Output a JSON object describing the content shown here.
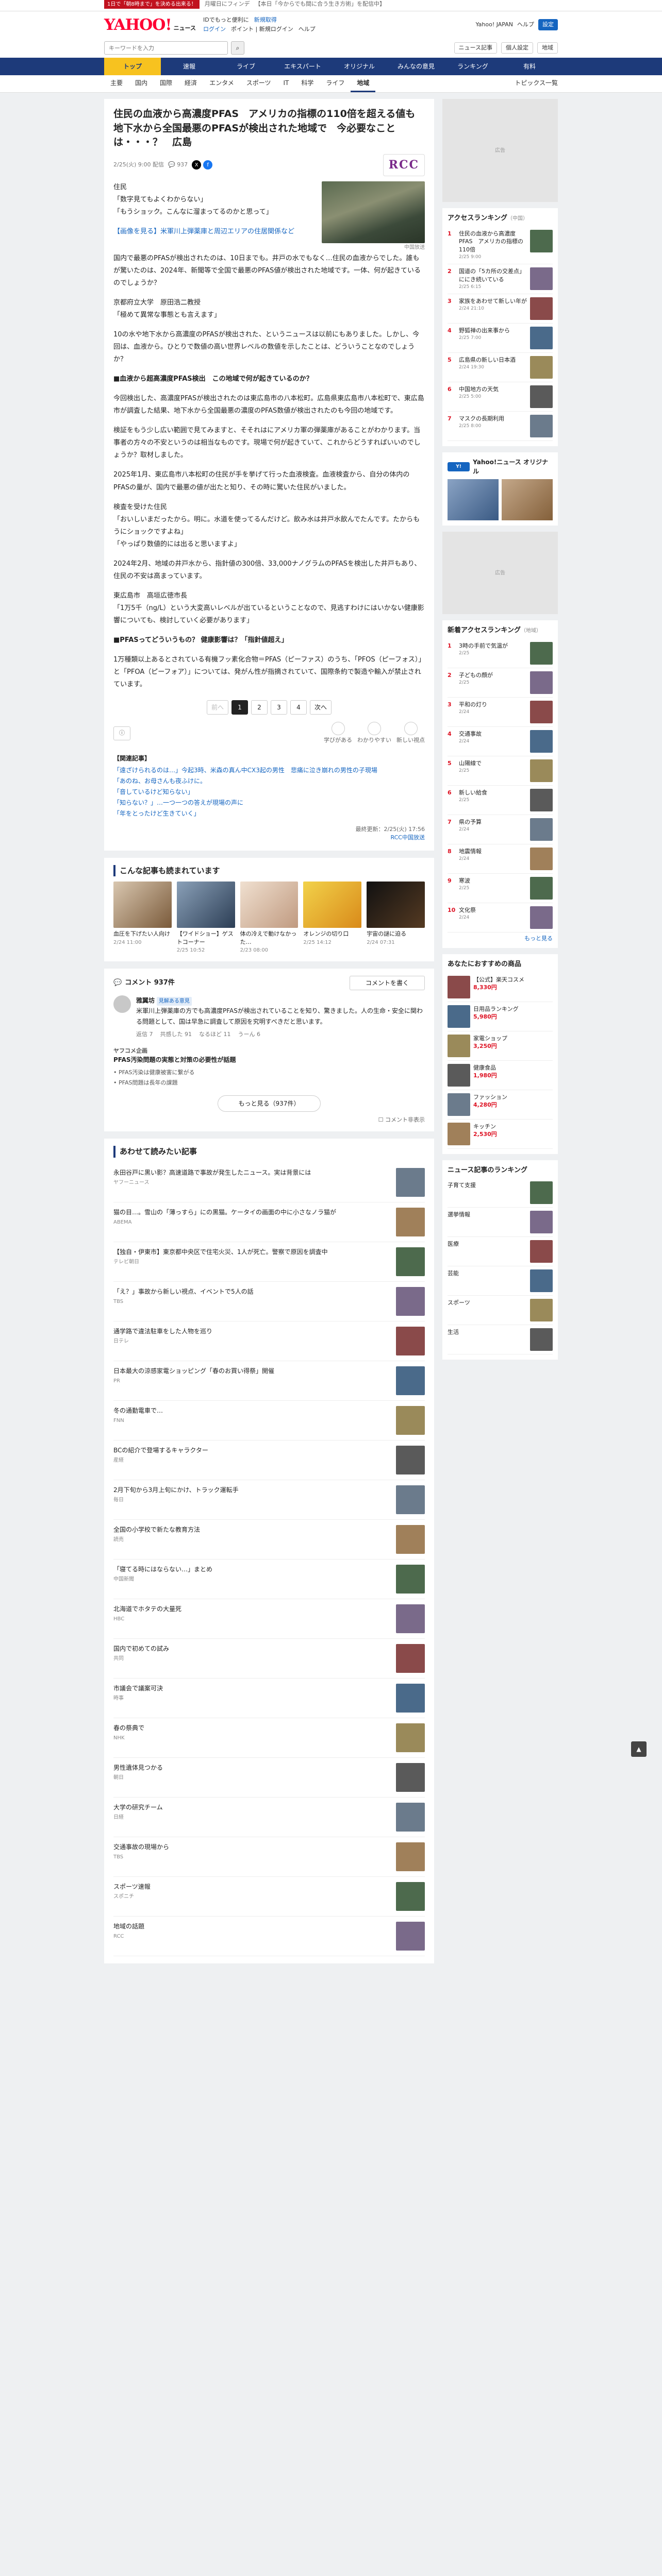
{
  "topstrip": {
    "promo": "1日で「朝8時まで」を決める出来る！",
    "notice": "月曜日にフィンデ",
    "news": "【本日「今からでも間に合う生き方術」を配信中】"
  },
  "header": {
    "brand": "YAHOO!",
    "brand_sub": "ニュース",
    "links_row1": [
      "IDでもっと便利に",
      "新規取得"
    ],
    "links_row2": [
      "ログイン",
      "ポイント | 新規ログイン",
      "ヘルプ"
    ],
    "right_links": [
      "Yahoo! JAPAN",
      "ヘルプ"
    ],
    "right_btn": "設定"
  },
  "search": {
    "placeholder": "キーワードを入力",
    "button": "検索",
    "right": [
      "ニュース記事",
      "個人設定",
      "地域"
    ]
  },
  "nav": [
    "トップ",
    "速報",
    "ライブ",
    "エキスパート",
    "オリジナル",
    "みんなの意見",
    "ランキング",
    "有料"
  ],
  "nav_active": "トップ",
  "subnav": [
    "主要",
    "国内",
    "国際",
    "経済",
    "エンタメ",
    "スポーツ",
    "IT",
    "科学",
    "ライフ",
    "地域"
  ],
  "subnav_active": "地域",
  "subnav_right": "トピックス一覧",
  "article": {
    "title": "住民の血液から高濃度PFAS　アメリカの指標の110倍を超える値も　地下水から全国最悪のPFASが検出された地域で　今必要なことは・・・？　広島",
    "date": "2/25(火) 9:00 配信",
    "comments": "937",
    "source": "RCC",
    "p1": "住民\n「数字見てもよくわからない」\n「もうショック。こんなに溜まってるのかと思って」",
    "photo_caption": "中国放送",
    "lead_link": "【画像を見る】米軍川上弾薬庫と周辺エリアの住居関係など",
    "p2": "国内で最悪のPFASが検出されたのは、10日までも。井戸の水でもなく…住民の血液からでした。誰もが驚いたのは、2024年、新聞等で全国で最悪のPFAS値が検出された地域です。一体、何が起きているのでしょうか？",
    "p3": "京都府立大学　原田浩二教授\n「極めて異常な事態とも言えます」",
    "p4": "10の水や地下水から高濃度のPFASが検出された、というニュースは以前にもありました。しかし、今回は、血液から。ひとりで数値の高い世界レベルの数値を示したことは、どういうことなのでしょうか？",
    "p5": "■血液から超高濃度PFAS検出　この地域で何が起きているのか？",
    "p6": "今回検出した、高濃度PFASが検出されたのは東広島市の八本松町。広島県東広島市八本松町で、東広島市が調査した結果、地下水から全国最悪の濃度のPFAS数値が検出されたのも今回の地域です。",
    "p7": "検証をもう少し広い範囲で見てみますと、そそれはにアメリカ軍の弾薬庫があることがわかります。当事者の方々の不安というのは相当なものです。現場で何が起きていて、これからどうすればいいのでしょうか？取材しました。",
    "p8": "2025年1月、東広島市八本松町の住民が手を挙げて行った血液検査。血液検査から、自分の体内のPFASの量が、国内で最悪の値が出たと知り、その時に驚いた住民がいました。",
    "p9": "検査を受けた住民\n「おいしいまだったから。明に。水道を使ってるんだけど。飲み水は井戸水飲んでたんです。たからもうにショックですよね」\n「やっぱり数値的には出ると思いますよ」",
    "p10": "2024年2月、地域の井戸水から、指針値の300倍、33,000ナノグラムのPFASを検出した井戸もあり、住民の不安は高まっています。",
    "p11": "東広島市　高垣広徳市長\n「1万5千（ng/L）という大変高いレベルが出ているということなので、見逃すわけにはいかない健康影響についても、検討していく必要があります」",
    "p12": "■PFASってどういうもの？ 健康影響は？「指針値超え」",
    "p13": "1万種類以上あるとされている有機フッ素化合物＝PFAS（ピーファス）のうち、「PFOS（ピーフォス）」と「PFOA（ピーフォア）」については、発がん性が指摘されていて、国際条約で製造や輸入が禁止されています。",
    "pages": [
      "前へ",
      "1",
      "2",
      "3",
      "4",
      "次へ"
    ],
    "reactions": [
      "学びがある",
      "わかりやすい",
      "新しい視点"
    ],
    "related_hd": "【関連記事】",
    "related": [
      "「遠ざけられるのは…」今起3時、米森の真ん中CX3起の男性　悲痛に泣き崩れの男性の子現場",
      "「あのね、お母さんも夜ふけに。",
      "「音しているけど知らない」",
      "「知らない？」…一つ一つの答えが現場の声に",
      "「年をとったけど生きていく」"
    ],
    "foot_src": "最終更新：2/25(火) 17:56",
    "foot_rcc": "RCC中国放送"
  },
  "read_also": {
    "title": "こんな記事も読まれています",
    "items": [
      {
        "t": "血圧を下げたい人向け",
        "d": "2/24 11:00"
      },
      {
        "t": "【ワイドショー】ゲストコーナー",
        "d": "2/25 10:52"
      },
      {
        "t": "体の冷えで動けなかった…",
        "d": "2/23 08:00"
      },
      {
        "t": "オレンジの切り口",
        "d": "2/25 14:12"
      },
      {
        "t": "宇宙の謎に迫る",
        "d": "2/24 07:31"
      }
    ]
  },
  "comments": {
    "count_label": "コメント 937件",
    "post": "コメントを書く",
    "author": "雅翼坊",
    "author_badge": "見解ある意見",
    "comment_text": "米軍川上弾薬庫の方でも高濃度PFASが検出されていることを知り、驚きました。人の生命・安全に関わる問題として、国は早急に調査して原因を究明すべきだと思います。",
    "footer": [
      "返信 7",
      "共感した 91",
      "なるほど 11",
      "うーん 6"
    ],
    "opinion_hd": "ヤフコメ企画",
    "opinion_title": "PFAS汚染問題の実態と対策の必要性が話題",
    "opinion_items": [
      "PFAS汚染は健康被害に繋がる",
      "PFAS問題は長年の課題"
    ],
    "more_btn": "もっと見る（937件）",
    "toggle": "コメント非表示"
  },
  "ranking": {
    "title": "あわせて読みたい記事",
    "items": [
      {
        "t": "永田谷戸に黒い影？高速道路で事故が発生したニュース。実は背景には",
        "s": "ヤフーニュース"
      },
      {
        "t": "猫の目…。雪山の「薄っすら」にの黒猫。ケータイの画面の中に小さなノラ猫が",
        "s": "ABEMA"
      },
      {
        "t": "【独自・伊東市】東京都中央区で住宅火災、1人が死亡。警察で原因を調査中",
        "s": "テレビ朝日"
      },
      {
        "t": "「え？」事故から新しい視点、イベントで5人の話",
        "s": "TBS"
      },
      {
        "t": "通学路で違法駐車をした人物を巡り",
        "s": "日テレ"
      },
      {
        "t": "日本最大の涼感家電ショッピング「春のお買い得祭」開催",
        "s": "PR"
      },
      {
        "t": "冬の通勤電車で…",
        "s": "FNN"
      },
      {
        "t": "BCの紹介で登場するキャラクター",
        "s": "産経"
      },
      {
        "t": "2月下旬から3月上旬にかけ、トラック運転手",
        "s": "毎日"
      },
      {
        "t": "全国の小学校で新たな教育方法",
        "s": "読売"
      },
      {
        "t": "「寝てる時にはならない…」まとめ",
        "s": "中国新聞"
      },
      {
        "t": "北海道でホタテの大量死",
        "s": "HBC"
      },
      {
        "t": "国内で初めての試み",
        "s": "共同"
      },
      {
        "t": "市議会で議案可決",
        "s": "時事"
      },
      {
        "t": "春の祭典で",
        "s": "NHK"
      },
      {
        "t": "男性遺体見つかる",
        "s": "朝日"
      },
      {
        "t": "大学の研究チーム",
        "s": "日経"
      },
      {
        "t": "交通事故の現場から",
        "s": "TBS"
      },
      {
        "t": "スポーツ速報",
        "s": "スポニチ"
      },
      {
        "t": "地域の話題",
        "s": "RCC"
      }
    ]
  },
  "sidebar": {
    "ad_label": "広告",
    "access_title": "アクセスランキング",
    "access_sub": "（中国）",
    "access": [
      {
        "t": "住民の血液から高濃度PFAS　アメリカの指標の110倍",
        "m": "2/25 9:00"
      },
      {
        "t": "国道の「5カ所の交差点」ににき続いている",
        "m": "2/25 6:15"
      },
      {
        "t": "家族をあわせて新しい年が",
        "m": "2/24 21:10"
      },
      {
        "t": "野狐禅の出来事から",
        "m": "2/25 7:00"
      },
      {
        "t": "広島県の新しい日本酒",
        "m": "2/24 19:30"
      },
      {
        "t": "中国地方の天気",
        "m": "2/25 5:00"
      },
      {
        "t": "マスクの長期利用",
        "m": "2/25 8:00"
      }
    ],
    "yt_title": "Yahoo!ニュース オリジナル",
    "news_title": "新着アクセスランキング",
    "news_sub": "（地域）",
    "news": [
      {
        "t": "3時の手前で気温が",
        "m": "2/25"
      },
      {
        "t": "子どもの顔が",
        "m": "2/25"
      },
      {
        "t": "平和の灯り",
        "m": "2/24"
      },
      {
        "t": "交通事故",
        "m": "2/24"
      },
      {
        "t": "山陽線で",
        "m": "2/25"
      },
      {
        "t": "新しい給食",
        "m": "2/25"
      },
      {
        "t": "県の予算",
        "m": "2/24"
      },
      {
        "t": "地震情報",
        "m": "2/24"
      },
      {
        "t": "寒波",
        "m": "2/25"
      },
      {
        "t": "文化祭",
        "m": "2/24"
      }
    ],
    "pick": "もっと見る",
    "shop_title": "あなたにおすすめの商品",
    "shop": [
      {
        "t": "【公式】楽天コスメ",
        "p": "8,330円"
      },
      {
        "t": "日用品ランキング",
        "p": "5,980円"
      },
      {
        "t": "家電ショップ",
        "p": "3,250円"
      },
      {
        "t": "健康食品",
        "p": "1,980円"
      },
      {
        "t": "ファッション",
        "p": "4,280円"
      },
      {
        "t": "キッチン",
        "p": "2,530円"
      }
    ],
    "topic_title": "ニュース記事のランキング",
    "topic": [
      {
        "t": "子育て支援",
        "m": ""
      },
      {
        "t": "選挙情報",
        "m": ""
      },
      {
        "t": "医療",
        "m": ""
      },
      {
        "t": "芸能",
        "m": ""
      },
      {
        "t": "スポーツ",
        "m": ""
      },
      {
        "t": "生活",
        "m": ""
      }
    ]
  },
  "pagetop": "▲"
}
